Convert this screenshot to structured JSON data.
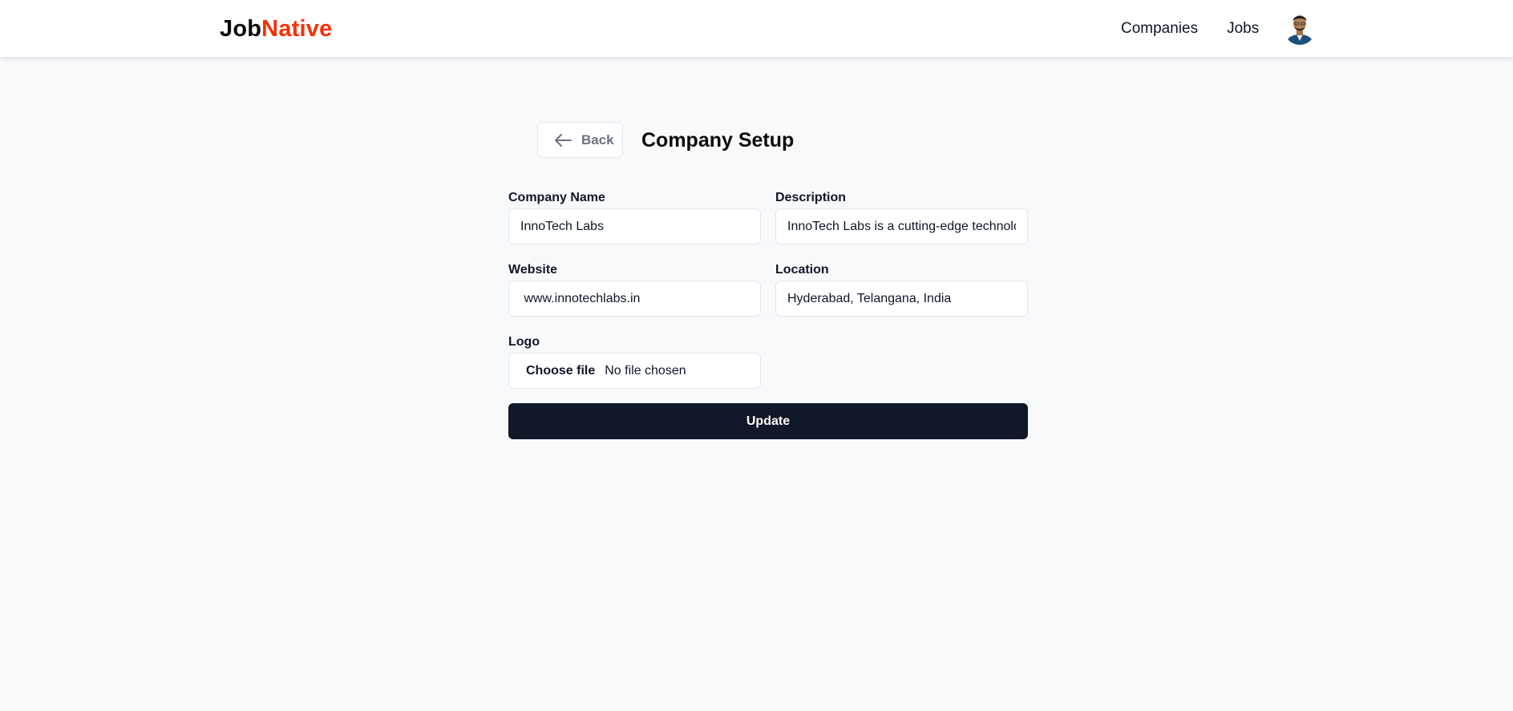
{
  "header": {
    "logo_part1": "Job",
    "logo_part2": "Native",
    "logo_accent_color": "#f83002",
    "nav": [
      {
        "label": "Companies"
      },
      {
        "label": "Jobs"
      }
    ],
    "avatar_icon": "user-avatar"
  },
  "page": {
    "back_label": "Back",
    "back_icon": "arrow-left-icon",
    "title": "Company Setup"
  },
  "form": {
    "company_name": {
      "label": "Company Name",
      "value": "InnoTech Labs"
    },
    "description": {
      "label": "Description",
      "value": "InnoTech Labs is a cutting-edge technolo"
    },
    "website": {
      "label": "Website",
      "value": " www.innotechlabs.in"
    },
    "location": {
      "label": "Location",
      "value": "Hyderabad, Telangana, India"
    },
    "logo": {
      "label": "Logo",
      "choose_label": "Choose file",
      "status": "No file chosen"
    },
    "submit_label": "Update"
  },
  "colors": {
    "primary_button": "#111827",
    "background": "#f8f9fb"
  }
}
